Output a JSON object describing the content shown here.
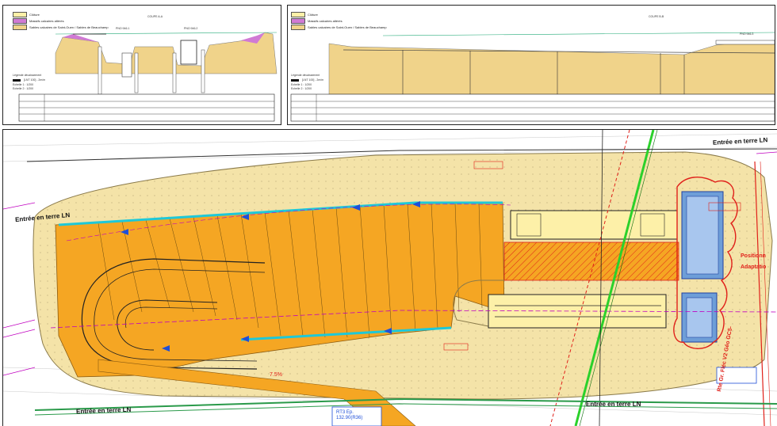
{
  "legend": {
    "items": [
      {
        "label": "Clôture",
        "color": "#fdf0a8"
      },
      {
        "label": "Massifs calcaires altérés",
        "color": "#d07ad4"
      },
      {
        "label": "Sables calcaires de Saint-Ouen / Sables de Beauchamp",
        "color": "#f0d38a"
      }
    ]
  },
  "sections": {
    "left_title": "COUPE A-A",
    "right_title": "COUPE B-B",
    "left_pk1": "PNO 946.1",
    "left_pk2": "PNO 946.2",
    "right_pk": "PNO 946.3",
    "scale_label": "Légende décaissement",
    "scale_note": "[LNT 100] - 2m/m",
    "echelle_h": "Echelle 1 : 1/200",
    "echelle_v": "Echelle 2 : 1/200"
  },
  "plan": {
    "entree_top_right": "Entrée en terre LN",
    "entree_left": "Entrée en terre LN",
    "entree_bottom_left": "Entrée en terre LN",
    "entree_bottom_right": "Entrée en terre LN",
    "slope_label": "7.5%",
    "rt_box": "RT3 Ep. 132.90(R36)",
    "right_label_1": "Positionn",
    "right_label_2": "Adaptatio",
    "vertical_label": "Rte Gr. Fléc V2 Géo GC5-"
  },
  "colors": {
    "orange_fill": "#f5a623",
    "earth_fill": "#f4e3a8",
    "water_line": "#1ec8d8",
    "magenta": "#c000c0",
    "red": "#e0201a",
    "green": "#2bd12b",
    "blue_box": "#6e9ed8"
  }
}
